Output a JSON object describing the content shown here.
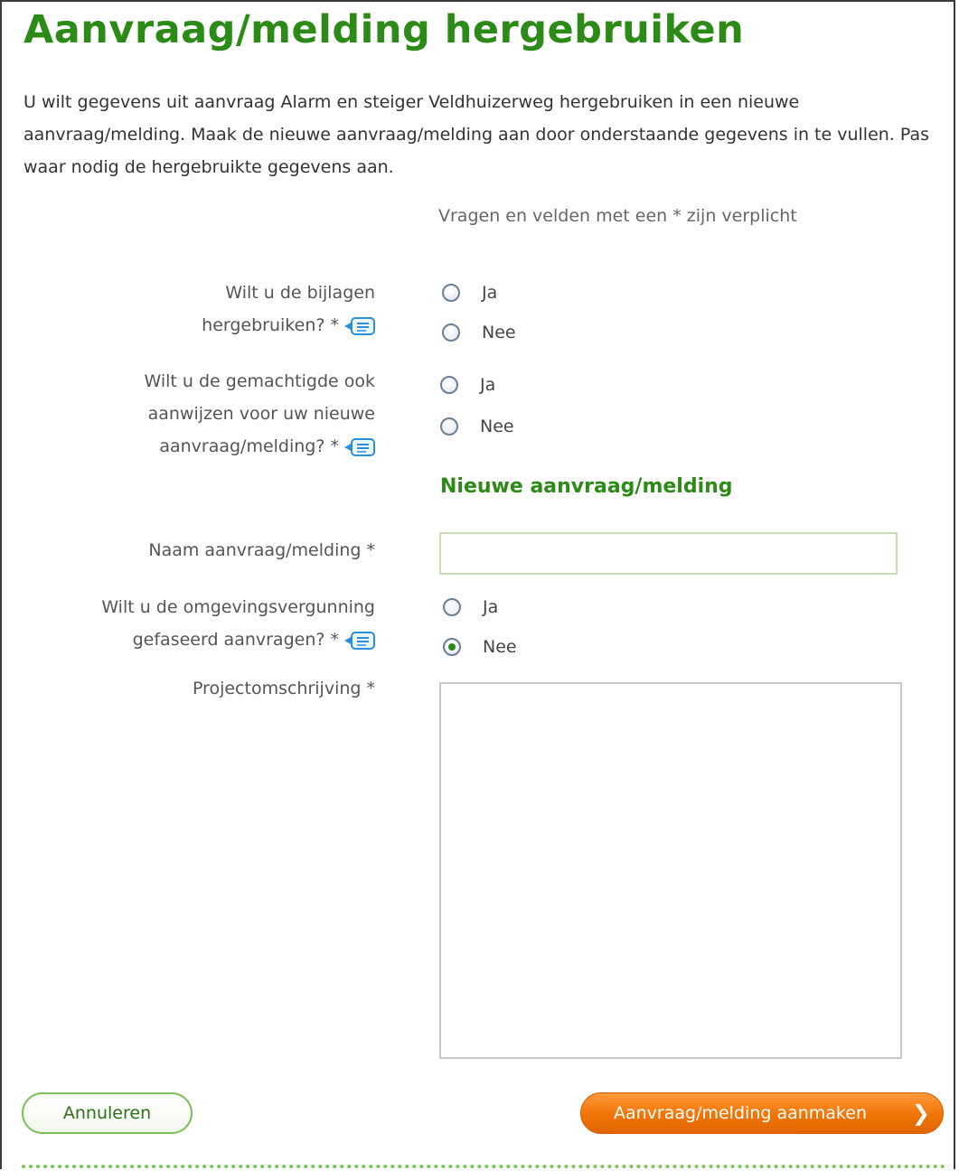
{
  "title": "Aanvraag/melding hergebruiken",
  "intro_text": "U wilt gegevens uit aanvraag Alarm en steiger Veldhuizerweg hergebruiken in een nieuwe aanvraag/melding. Maak de nieuwe aanvraag/melding aan door onderstaande gegevens in te vullen. Pas waar nodig de hergebruikte gegevens aan.",
  "required_note": "Vragen en velden met een * zijn verplicht",
  "questions": {
    "bijlagen": {
      "label_line1": "Wilt u de bijlagen",
      "label_line2": "hergebruiken? *",
      "option_yes": "Ja",
      "option_no": "Nee",
      "selected": null
    },
    "gemachtigde": {
      "label_line1": "Wilt u de gemachtigde ook",
      "label_line2": "aanwijzen voor uw nieuwe",
      "label_line3": "aanvraag/melding? *",
      "option_yes": "Ja",
      "option_no": "Nee",
      "selected": null
    },
    "gefaseerd": {
      "label_line1": "Wilt u de omgevingsvergunning",
      "label_line2": "gefaseerd aanvragen? *",
      "option_yes": "Ja",
      "option_no": "Nee",
      "selected": "Nee"
    }
  },
  "section_title": "Nieuwe aanvraag/melding",
  "naam": {
    "label": "Naam aanvraag/melding *",
    "value": ""
  },
  "projectomschrijving": {
    "label": "Projectomschrijving *",
    "value": ""
  },
  "buttons": {
    "cancel": "Annuleren",
    "submit": "Aanvraag/melding aanmaken",
    "submit_arrow": "❯"
  },
  "colors": {
    "title_green": "#2c8b16",
    "submit_orange": "#f07405",
    "divider_green": "#7cc35a"
  },
  "icons": {
    "help": "help-balloon-icon"
  }
}
